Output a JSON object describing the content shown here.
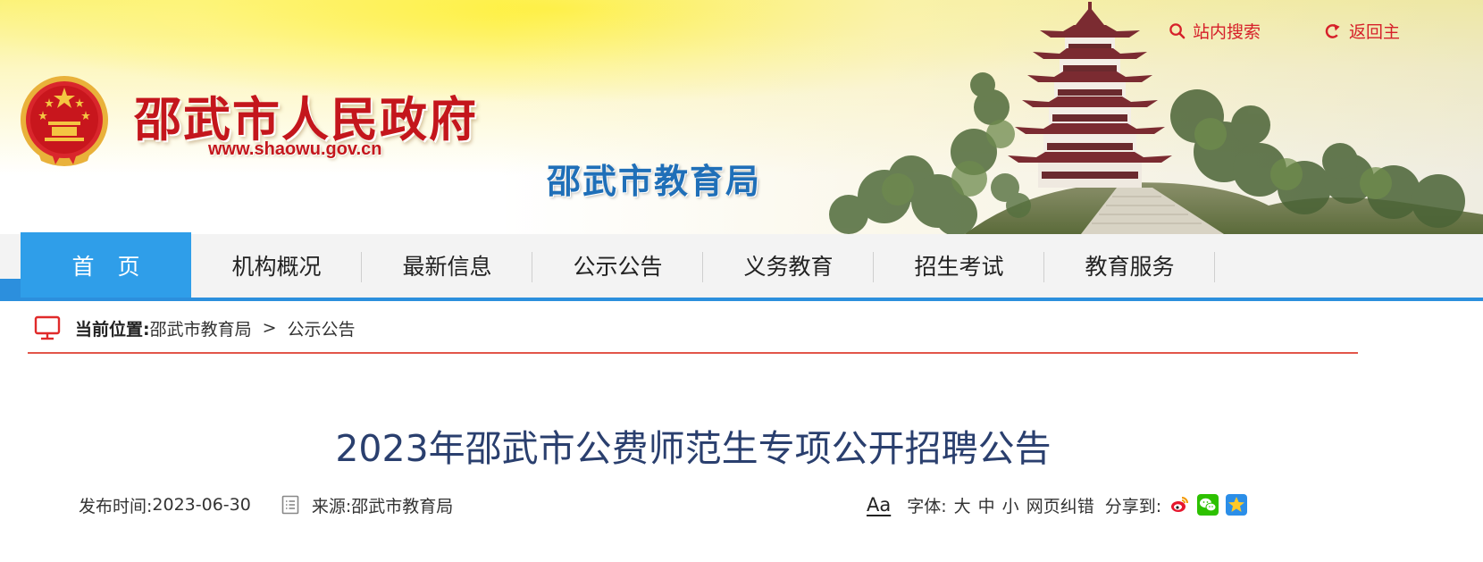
{
  "header": {
    "site_title": "邵武市人民政府",
    "site_url": "www.shaowu.gov.cn",
    "department": "邵武市教育局",
    "search_label": "站内搜索",
    "home_label": "返回主"
  },
  "nav": {
    "items": [
      {
        "label": "首页",
        "active": true
      },
      {
        "label": "机构概况"
      },
      {
        "label": "最新信息"
      },
      {
        "label": "公示公告"
      },
      {
        "label": "义务教育"
      },
      {
        "label": "招生考试"
      },
      {
        "label": "教育服务"
      }
    ]
  },
  "breadcrumb": {
    "label": "当前位置:",
    "items": [
      "邵武市教育局",
      "公示公告"
    ],
    "separator": ">"
  },
  "article": {
    "title": "2023年邵武市公费师范生专项公开招聘公告",
    "publish_label": "发布时间:",
    "publish_date": "2023-06-30",
    "source_label": "来源:",
    "source": "邵武市教育局",
    "aa_label": "Aa",
    "font_label": "字体:",
    "font_sizes": [
      "大",
      "中",
      "小"
    ],
    "correction_label": "网页纠错",
    "share_label": "分享到:",
    "share_targets": [
      "weibo-icon",
      "wechat-icon",
      "qzone-icon"
    ]
  },
  "colors": {
    "brand_red": "#c4161c",
    "nav_active": "#2f9ee9",
    "nav_line": "#2c8fdd",
    "title_blue": "#2a3f6e",
    "dept_blue": "#1f6fb8"
  }
}
